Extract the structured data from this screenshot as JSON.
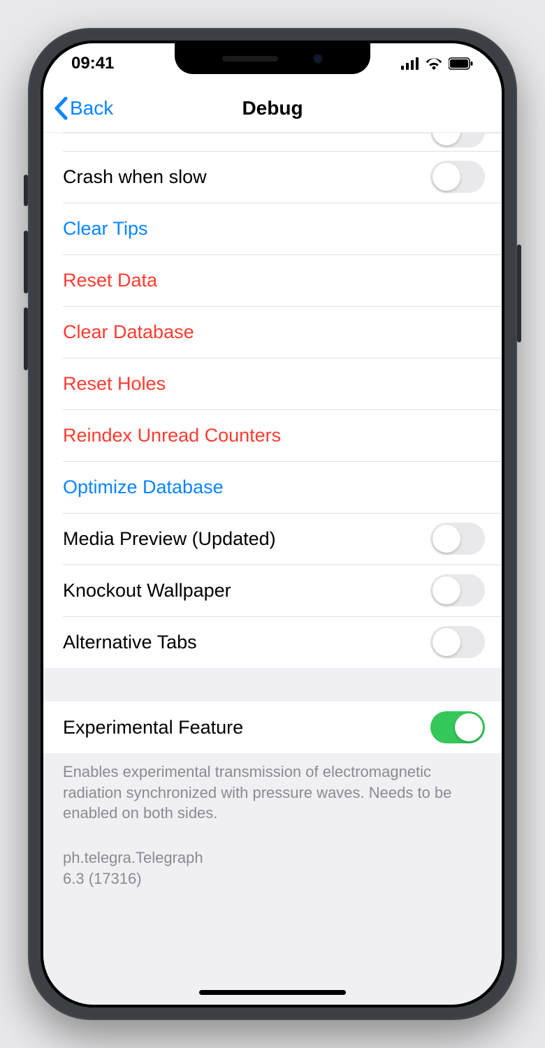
{
  "status": {
    "time": "09:41"
  },
  "nav": {
    "back": "Back",
    "title": "Debug"
  },
  "rows": {
    "crash_when_slow": {
      "label": "Crash when slow",
      "type": "switch",
      "on": false
    },
    "clear_tips": {
      "label": "Clear Tips",
      "type": "link",
      "style": "blue"
    },
    "reset_data": {
      "label": "Reset Data",
      "type": "link",
      "style": "red"
    },
    "clear_database": {
      "label": "Clear Database",
      "type": "link",
      "style": "red"
    },
    "reset_holes": {
      "label": "Reset Holes",
      "type": "link",
      "style": "red"
    },
    "reindex_unread": {
      "label": "Reindex Unread Counters",
      "type": "link",
      "style": "red"
    },
    "optimize_db": {
      "label": "Optimize Database",
      "type": "link",
      "style": "blue"
    },
    "media_preview": {
      "label": "Media Preview (Updated)",
      "type": "switch",
      "on": false
    },
    "knockout_wallpaper": {
      "label": "Knockout Wallpaper",
      "type": "switch",
      "on": false
    },
    "alternative_tabs": {
      "label": "Alternative Tabs",
      "type": "switch",
      "on": false
    },
    "experimental": {
      "label": "Experimental Feature",
      "type": "switch",
      "on": true
    }
  },
  "footer": {
    "description": "Enables experimental transmission of electromagnetic radiation synchronized with pressure waves. Needs to be enabled on both sides.",
    "bundle": "ph.telegra.Telegraph",
    "version": "6.3 (17316)"
  }
}
